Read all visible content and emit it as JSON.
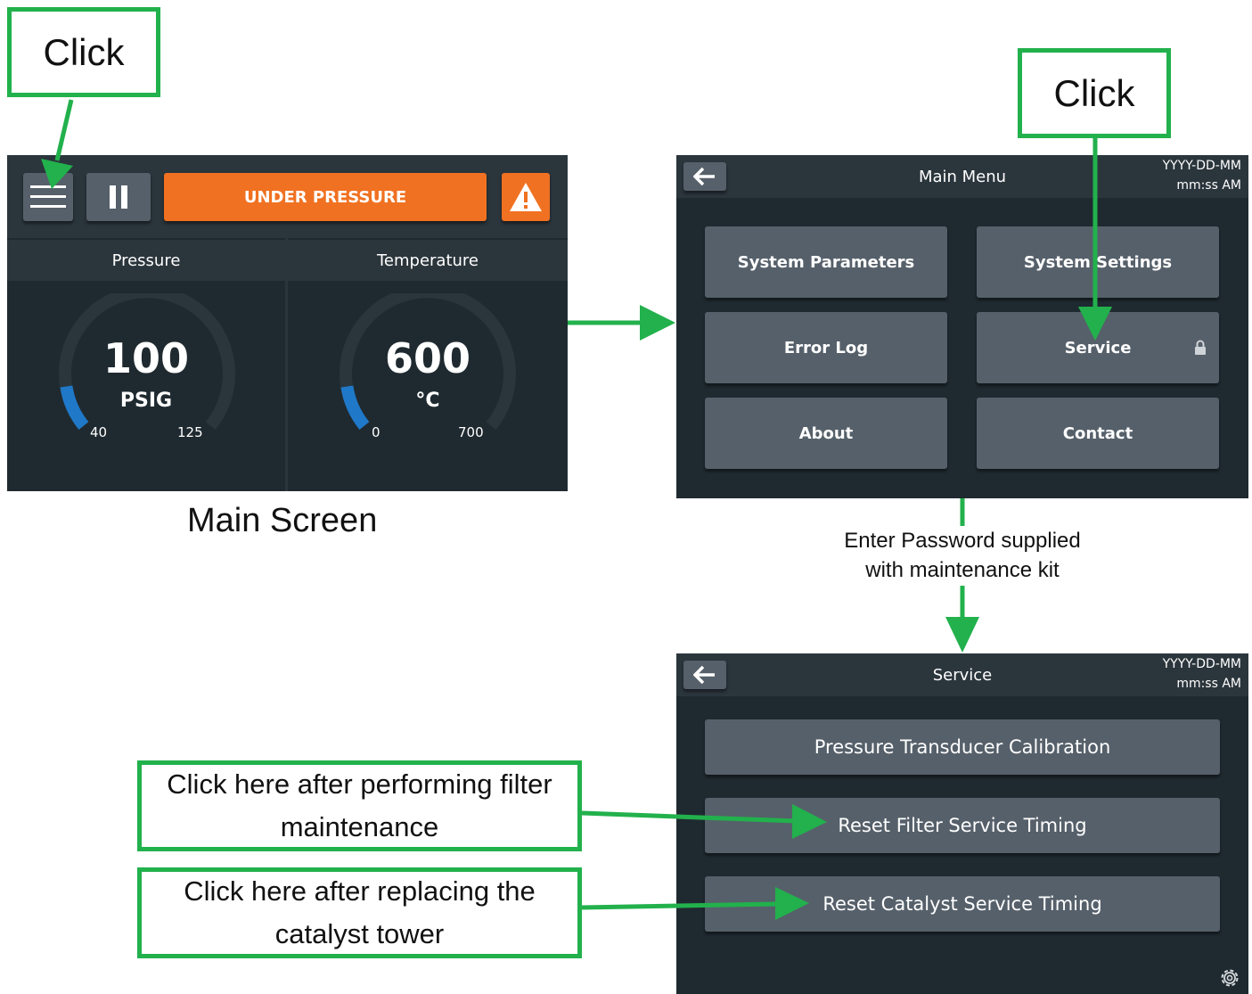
{
  "callouts": {
    "click_top_left": "Click",
    "click_top_right": "Click",
    "filter_note": "Click here after performing filter maintenance",
    "catalyst_note": "Click here after replacing the catalyst tower",
    "password_note_line1": "Enter Password supplied",
    "password_note_line2": "with maintenance kit"
  },
  "main_screen": {
    "caption": "Main Screen",
    "status_label": "UNDER PRESSURE",
    "pressure": {
      "header": "Pressure",
      "value": "100",
      "unit": "PSIG",
      "min_label": "40",
      "max_label": "125",
      "fraction": 0.12
    },
    "temperature": {
      "header": "Temperature",
      "value": "600",
      "unit": "°C",
      "min_label": "0",
      "max_label": "700",
      "fraction": 0.12
    }
  },
  "main_menu": {
    "title": "Main Menu",
    "date": "YYYY-DD-MM",
    "time": "mm:ss AM",
    "items": [
      {
        "label": "System Parameters"
      },
      {
        "label": "System Settings"
      },
      {
        "label": "Error Log"
      },
      {
        "label": "Service"
      },
      {
        "label": "About"
      },
      {
        "label": "Contact"
      }
    ]
  },
  "service_menu": {
    "title": "Service",
    "date": "YYYY-DD-MM",
    "time": "mm:ss AM",
    "items": [
      {
        "label": "Pressure Transducer Calibration"
      },
      {
        "label": "Reset Filter Service Timing"
      },
      {
        "label": "Reset Catalyst Service Timing"
      }
    ]
  },
  "colors": {
    "accent_green": "#22b14c",
    "status_orange": "#f07121",
    "gauge_blue": "#1f78c8",
    "panel_bg": "#1f2a30",
    "button_gray": "#56606a"
  },
  "icons": [
    "menu-icon",
    "pause-icon",
    "warning-icon",
    "back-arrow-icon",
    "lock-icon",
    "gear-icon"
  ]
}
